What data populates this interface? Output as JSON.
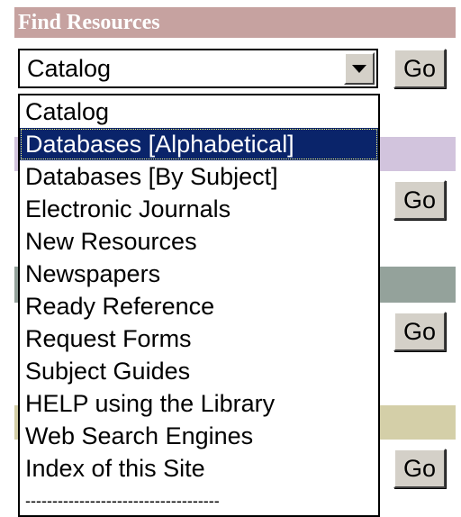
{
  "header": {
    "title": "Find Resources"
  },
  "select": {
    "value": "Catalog"
  },
  "buttons": {
    "go_label": "Go"
  },
  "dropdown": {
    "options": [
      "Catalog",
      "Databases [Alphabetical]",
      "Databases [By Subject]",
      "Electronic Journals",
      "New Resources",
      "Newspapers",
      "Ready Reference",
      "Request Forms",
      "Subject Guides",
      "HELP using the Library",
      "Web Search Engines",
      "Index of this Site",
      "------------------------------------"
    ],
    "highlighted": "Databases [Alphabetical]"
  },
  "colors": {
    "title_bar": "#c6a2a0",
    "purple_bar": "#d2c4dd",
    "gray_bar": "#94a29b",
    "khaki_bar": "#d4cfa8",
    "selection": "#0a246a"
  }
}
